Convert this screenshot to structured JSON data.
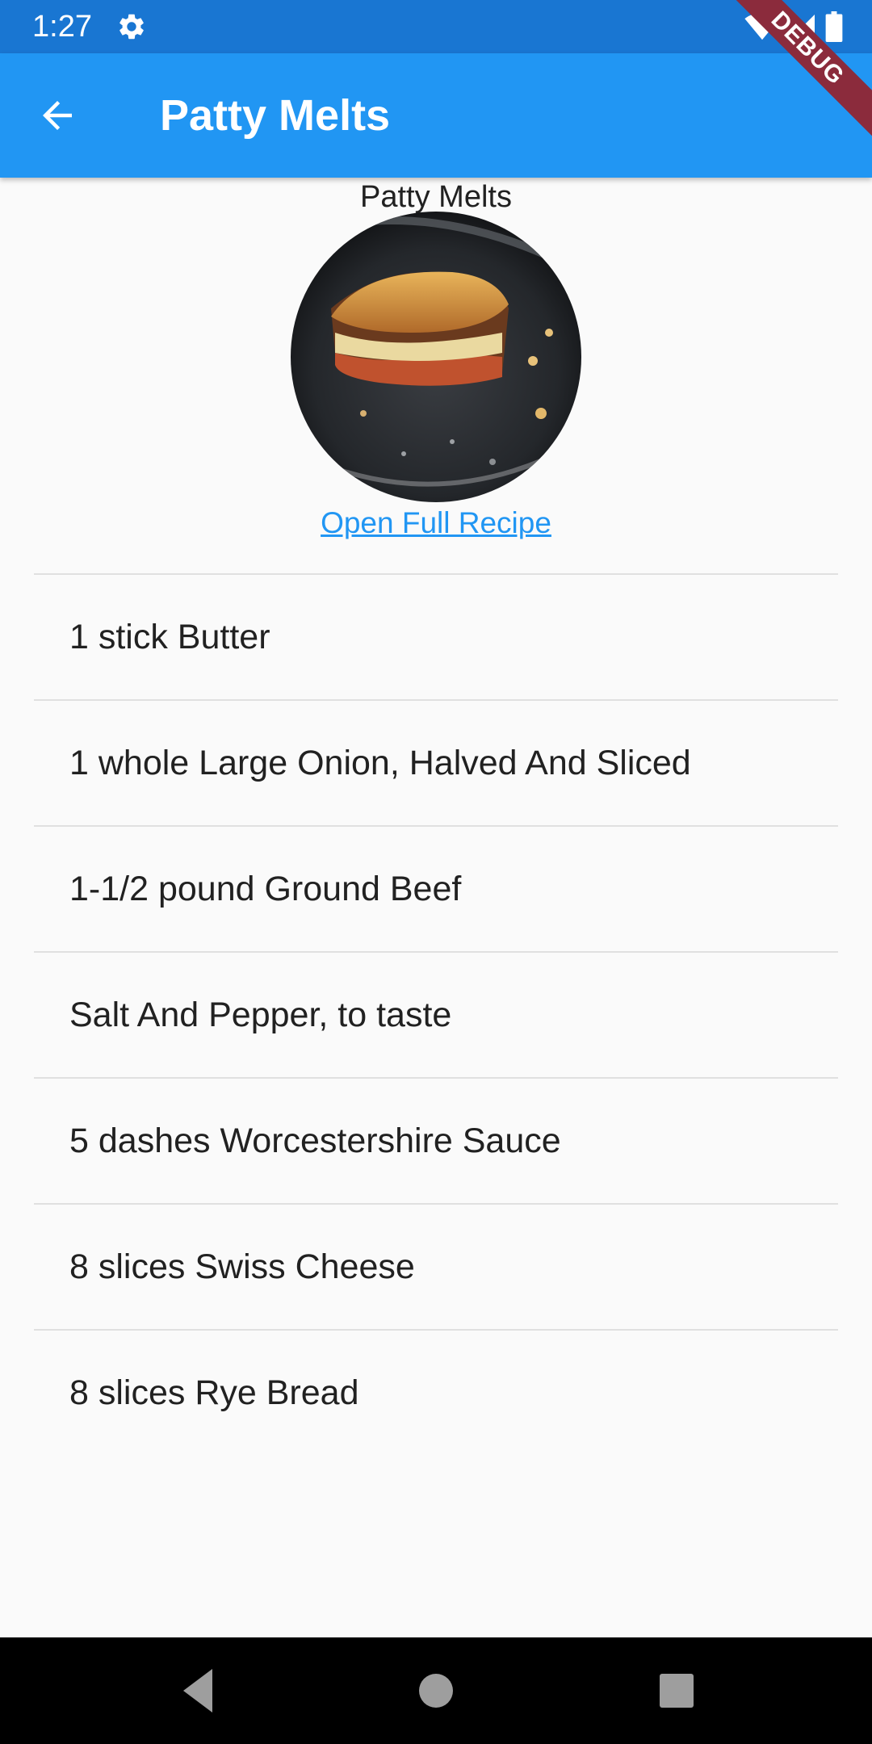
{
  "status_bar": {
    "time": "1:27",
    "icons": [
      "gear-icon",
      "wifi-icon",
      "cellular-signal-icon",
      "battery-icon"
    ]
  },
  "app_bar": {
    "title": "Patty Melts",
    "back_icon": "arrow-back-icon",
    "color": "#2196f3"
  },
  "debug_banner": {
    "label": "DEBUG"
  },
  "recipe": {
    "title": "Patty Melts",
    "link_label": "Open Full Recipe",
    "link_color": "#2196f3"
  },
  "ingredients": [
    "1 stick Butter",
    "1 whole Large Onion, Halved And Sliced",
    "1-1/2 pound Ground Beef",
    "Salt And Pepper, to taste",
    "5 dashes Worcestershire Sauce",
    "8 slices Swiss Cheese",
    "8 slices Rye Bread"
  ],
  "nav_bar": {
    "icons": [
      "back-triangle-icon",
      "home-circle-icon",
      "recents-square-icon"
    ]
  }
}
